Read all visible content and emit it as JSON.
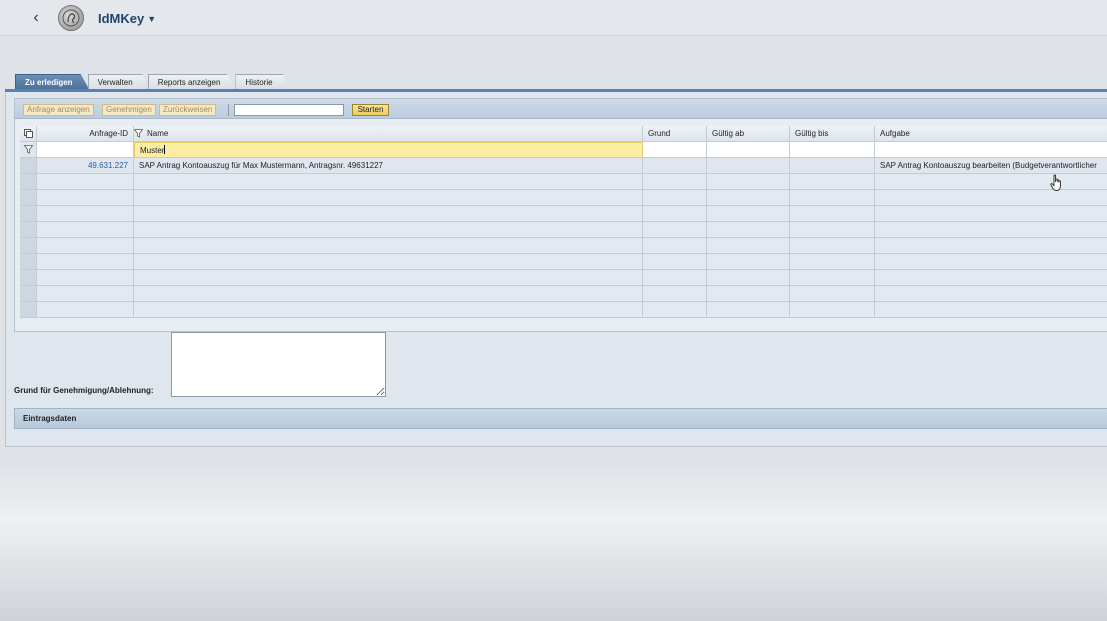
{
  "shell": {
    "back_icon": "chevron-left-icon",
    "title": "IdMKey",
    "caret": "▼"
  },
  "tabs": [
    {
      "label": "Zu erledigen",
      "active": true
    },
    {
      "label": "Verwalten",
      "active": false
    },
    {
      "label": "Reports anzeigen",
      "active": false
    },
    {
      "label": "Historie",
      "active": false
    }
  ],
  "toolbar": {
    "btn_show": "Anfrage anzeigen",
    "btn_approve": "Genehmigen",
    "btn_reject": "Zurückweisen",
    "search_value": "",
    "btn_start": "Starten"
  },
  "table": {
    "headers": {
      "id": "Anfrage-ID",
      "name": "Name",
      "grund": "Grund",
      "gab": "Gültig ab",
      "gbis": "Gültig bis",
      "aufgabe": "Aufgabe"
    },
    "filter": {
      "name": "Muster"
    },
    "rows": [
      {
        "id": "49.631.227",
        "name": "SAP Antrag Kontoauszug für Max Mustermann, Antragsnr. 49631227",
        "grund": "",
        "gab": "",
        "gbis": "",
        "aufgabe": "SAP Antrag Kontoauszug bearbeiten (Budgetverantwortlicher"
      }
    ]
  },
  "reason": {
    "label": "Grund für Genehmigung/Ablehnung:",
    "value": ""
  },
  "section": {
    "title": "Eintragsdaten"
  },
  "colors": {
    "tab_active": "#5b82ad",
    "filter_highlight": "#fbeea3",
    "link": "#2a5e9e"
  }
}
